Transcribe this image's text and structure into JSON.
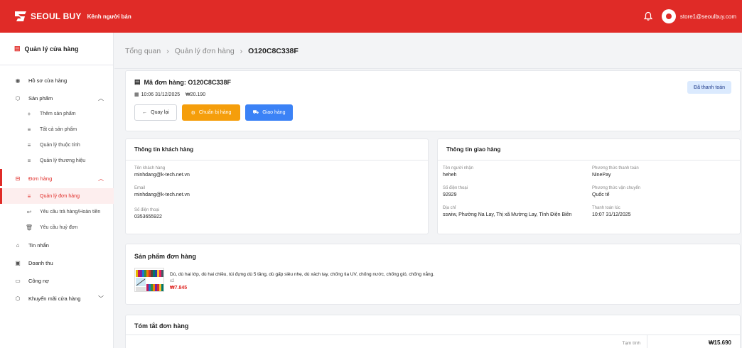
{
  "topbar": {
    "brand": "SEOUL BUY",
    "seller_label": "Kênh người bán",
    "user_email": "store1@seoulbuy.com",
    "bg_color": "#e02b27"
  },
  "sidebar": {
    "title": "Quản lý cửa hàng",
    "items": [
      {
        "label": "Hồ sơ cửa hàng",
        "icon": "store-profile-icon"
      },
      {
        "label": "Sản phẩm",
        "icon": "product-box-icon"
      },
      {
        "label": "Thêm sản phẩm",
        "icon": "plus-icon"
      },
      {
        "label": "Tất cả sản phẩm",
        "icon": "list-icon"
      },
      {
        "label": "Quản lý thuộc tính",
        "icon": "list-icon"
      },
      {
        "label": "Quản lý thương hiệu",
        "icon": "list-icon"
      },
      {
        "label": "Đơn hàng",
        "icon": "cart-icon"
      },
      {
        "label": "Quản lý đơn hàng",
        "icon": "list-icon"
      },
      {
        "label": "Yêu cầu trả hàng/Hoàn tiền",
        "icon": "return-icon"
      },
      {
        "label": "Yêu cầu huỷ đơn",
        "icon": "trash-icon"
      },
      {
        "label": "Tin nhắn",
        "icon": "chat-icon"
      },
      {
        "label": "Doanh thu",
        "icon": "revenue-icon"
      },
      {
        "label": "Công nợ",
        "icon": "wallet-icon"
      },
      {
        "label": "Khuyến mãi cửa hàng",
        "icon": "promo-icon"
      }
    ]
  },
  "breadcrumb": {
    "items": [
      "Tổng quan",
      "Quản lý đơn hàng",
      "O120C8C338F"
    ]
  },
  "order": {
    "title": "Mã đơn hàng: O120C8C338F",
    "datetime": "10:06 31/12/2025",
    "amount": "₩20.190",
    "status": "Đã thanh toán",
    "buttons": {
      "back": "Quay lại",
      "prepare": "Chuẩn bị hàng",
      "ship": "Giao hàng"
    }
  },
  "customer": {
    "heading": "Thông tin khách hàng",
    "name_label": "Tên khách hàng",
    "name": "minhdang@k-tech.net.vn",
    "email_label": "Email",
    "email": "minhdang@k-tech.net.vn",
    "phone_label": "Số điện thoại",
    "phone": "0353655922"
  },
  "shipping": {
    "heading": "Thông tin giao hàng",
    "receiver_label": "Tên người nhận",
    "receiver": "heheh",
    "phone_label": "Số điện thoại",
    "phone": "92929",
    "address_label": "Địa chỉ",
    "address": "sswiw, Phường Na Lay, Thị xã Mường Lay, Tỉnh Điện Biên",
    "payment_method_label": "Phương thức thanh toán",
    "payment_method": "NinePay",
    "shipping_method_label": "Phương thức vận chuyển",
    "shipping_method": "Quốc tế",
    "paid_at_label": "Thanh toán lúc",
    "paid_at": "10:07 31/12/2025"
  },
  "products": {
    "heading": "Sản phẩm đơn hàng",
    "items": [
      {
        "name": "Dù, dù hai lớp, dù hai chiều, túi đựng dù 5 tầng, dù gấp siêu nhẹ, dù xách tay, chống tia UV, chống nước, chống gió, chống nắng.",
        "qty": "x2",
        "price": "₩7.845"
      }
    ]
  },
  "summary": {
    "heading": "Tóm tắt đơn hàng",
    "subtotal_label": "Tạm tính",
    "subtotal": "₩15.690"
  }
}
